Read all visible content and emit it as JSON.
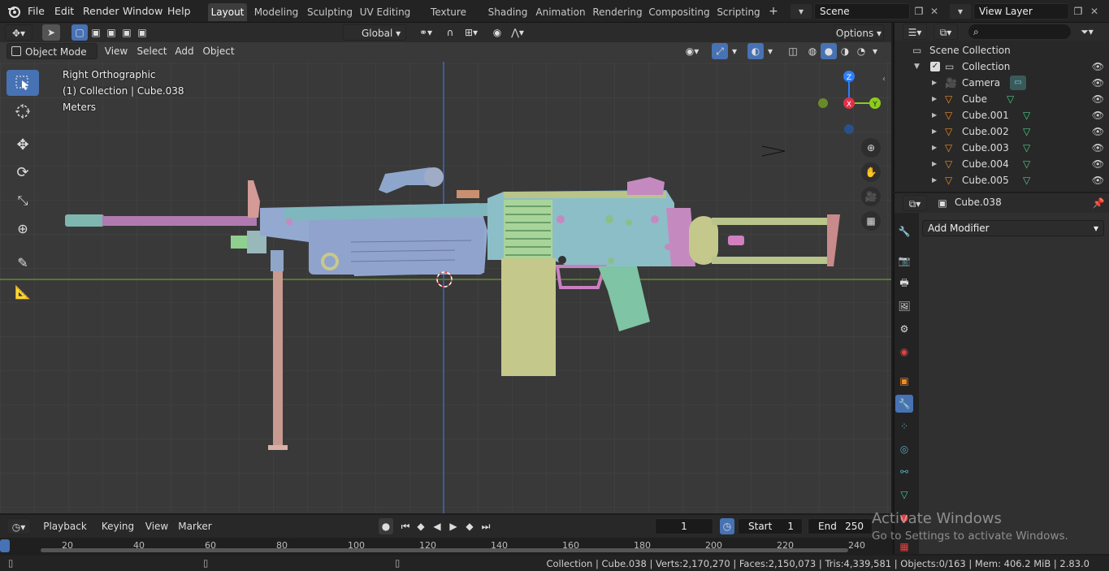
{
  "menus": [
    "File",
    "Edit",
    "Render",
    "Window",
    "Help"
  ],
  "workspaces": [
    {
      "label": "Layout",
      "active": true
    },
    {
      "label": "Modeling",
      "active": false
    },
    {
      "label": "Sculpting",
      "active": false
    },
    {
      "label": "UV Editing",
      "active": false
    },
    {
      "label": "Texture Paint",
      "active": false
    },
    {
      "label": "Shading",
      "active": false
    },
    {
      "label": "Animation",
      "active": false
    },
    {
      "label": "Rendering",
      "active": false
    },
    {
      "label": "Compositing",
      "active": false
    },
    {
      "label": "Scripting",
      "active": false
    }
  ],
  "scene": {
    "name": "Scene",
    "view_layer": "View Layer"
  },
  "toolbar_header": {
    "orientation": "Global",
    "options": "Options"
  },
  "viewport_header": {
    "mode": "Object Mode",
    "menus": [
      "View",
      "Select",
      "Add",
      "Object"
    ]
  },
  "overlay": {
    "view_name": "Right Orthographic",
    "collection_info": "(1) Collection | Cube.038",
    "units": "Meters"
  },
  "gizmo": {
    "z": "Z",
    "x": "X",
    "y": "Y"
  },
  "outliner": {
    "root": "Scene Collection",
    "collection": "Collection",
    "items": [
      "Camera",
      "Cube",
      "Cube.001",
      "Cube.002",
      "Cube.003",
      "Cube.004",
      "Cube.005"
    ]
  },
  "properties": {
    "object": "Cube.038",
    "add_modifier": "Add Modifier"
  },
  "timeline": {
    "menus": [
      "Playback",
      "Keying",
      "View",
      "Marker"
    ],
    "current_frame": "1",
    "start_label": "Start",
    "start": "1",
    "end_label": "End",
    "end": "250",
    "ruler": [
      "20",
      "40",
      "60",
      "80",
      "100",
      "120",
      "140",
      "160",
      "180",
      "200",
      "220",
      "240"
    ]
  },
  "watermark": {
    "title": "Activate Windows",
    "subtitle": "Go to Settings to activate Windows."
  },
  "status": "Collection | Cube.038 | Verts:2,170,270 | Faces:2,150,073 | Tris:4,339,581 | Objects:0/163 | Mem: 406.2 MiB | 2.83.0",
  "colors": {
    "accent": "#4772b3",
    "viewport_bg": "#393939",
    "x_axis": "#e0304a",
    "y_axis": "#8ccc1a",
    "z_axis": "#2b7fff"
  }
}
